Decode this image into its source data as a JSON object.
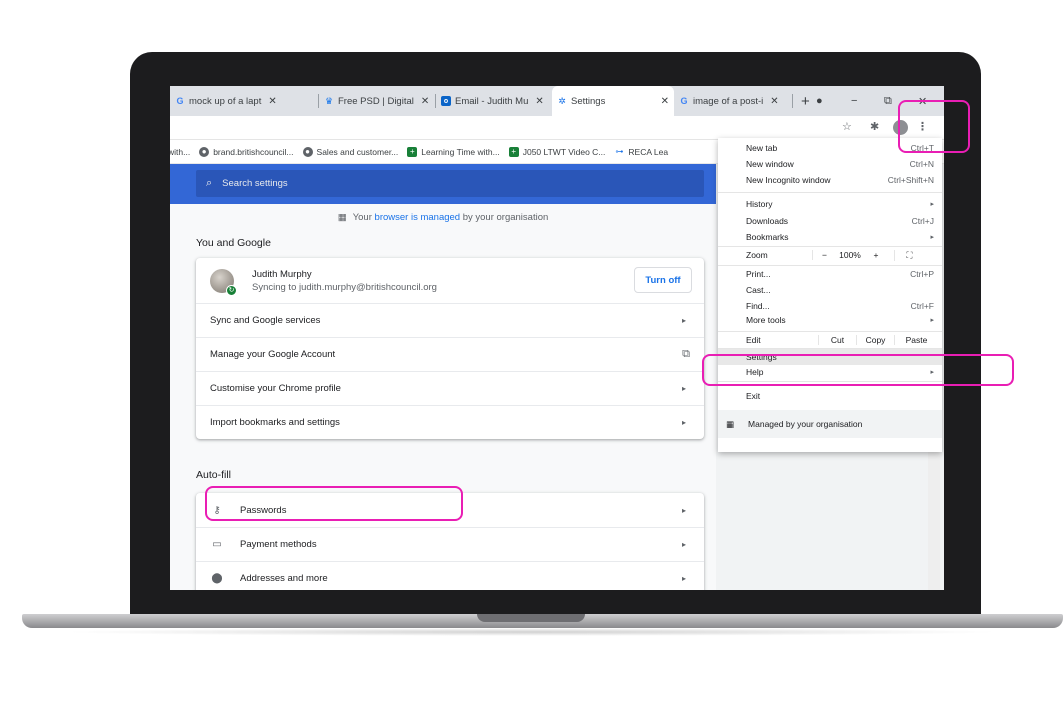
{
  "colors": {
    "chrome_blue": "#3367d6",
    "link_blue": "#1a73e8",
    "annotation_pink": "#e91eb4",
    "sync_green": "#188038"
  },
  "tabs": [
    {
      "label": "mock up of a lapt",
      "icon": "google-icon",
      "active": false
    },
    {
      "label": "Free PSD | Digital",
      "icon": "freepik-icon",
      "active": false
    },
    {
      "label": "Email - Judith Mu",
      "icon": "outlook-icon",
      "active": false
    },
    {
      "label": "Settings",
      "icon": "settings-gear-icon",
      "active": true
    },
    {
      "label": "image of a post-i",
      "icon": "google-icon",
      "active": false
    }
  ],
  "new_tab_symbol": "+",
  "window_controls": {
    "minimize": "−",
    "restore": "⧉",
    "close": "✕"
  },
  "bookmarks": [
    {
      "label": "with...",
      "icon": "none"
    },
    {
      "label": "brand.britishcouncil...",
      "icon": "globe-icon"
    },
    {
      "label": "Sales and customer...",
      "icon": "globe-icon"
    },
    {
      "label": "Learning Time with...",
      "icon": "sheets-icon"
    },
    {
      "label": "J050 LTWT Video C...",
      "icon": "sheets-icon"
    },
    {
      "label": "RECA Lea",
      "icon": "tree-icon"
    }
  ],
  "search": {
    "placeholder": "Search settings"
  },
  "managed_note": {
    "prefix": "Your ",
    "link": "browser is managed",
    "suffix": " by your organisation"
  },
  "you_and_google": {
    "title": "You and Google",
    "profile": {
      "name": "Judith Murphy",
      "email": "Syncing to judith.murphy@britishcouncil.org",
      "button": "Turn off"
    },
    "rows": [
      {
        "label": "Sync and Google services",
        "trail": "arrow"
      },
      {
        "label": "Manage your Google Account",
        "trail": "external"
      },
      {
        "label": "Customise your Chrome profile",
        "trail": "arrow"
      },
      {
        "label": "Import bookmarks and settings",
        "trail": "arrow"
      }
    ]
  },
  "autofill": {
    "title": "Auto-fill",
    "rows": [
      {
        "label": "Passwords",
        "icon": "key-icon"
      },
      {
        "label": "Payment methods",
        "icon": "credit-card-icon"
      },
      {
        "label": "Addresses and more",
        "icon": "location-pin-icon"
      }
    ]
  },
  "menu": {
    "new_tab": {
      "label": "New tab",
      "shortcut": "Ctrl+T"
    },
    "new_window": {
      "label": "New window",
      "shortcut": "Ctrl+N"
    },
    "new_incognito": {
      "label": "New Incognito window",
      "shortcut": "Ctrl+Shift+N"
    },
    "history": {
      "label": "History"
    },
    "downloads": {
      "label": "Downloads",
      "shortcut": "Ctrl+J"
    },
    "bookmarks": {
      "label": "Bookmarks"
    },
    "zoom": {
      "label": "Zoom",
      "minus": "−",
      "value": "100%",
      "plus": "+",
      "fullscreen": "⛶"
    },
    "print": {
      "label": "Print...",
      "shortcut": "Ctrl+P"
    },
    "cast": {
      "label": "Cast..."
    },
    "find": {
      "label": "Find...",
      "shortcut": "Ctrl+F"
    },
    "more_tools": {
      "label": "More tools"
    },
    "edit": {
      "label": "Edit",
      "cut": "Cut",
      "copy": "Copy",
      "paste": "Paste"
    },
    "settings": {
      "label": "Settings"
    },
    "help": {
      "label": "Help"
    },
    "exit": {
      "label": "Exit"
    },
    "managed": {
      "label": "Managed by your organisation"
    }
  }
}
